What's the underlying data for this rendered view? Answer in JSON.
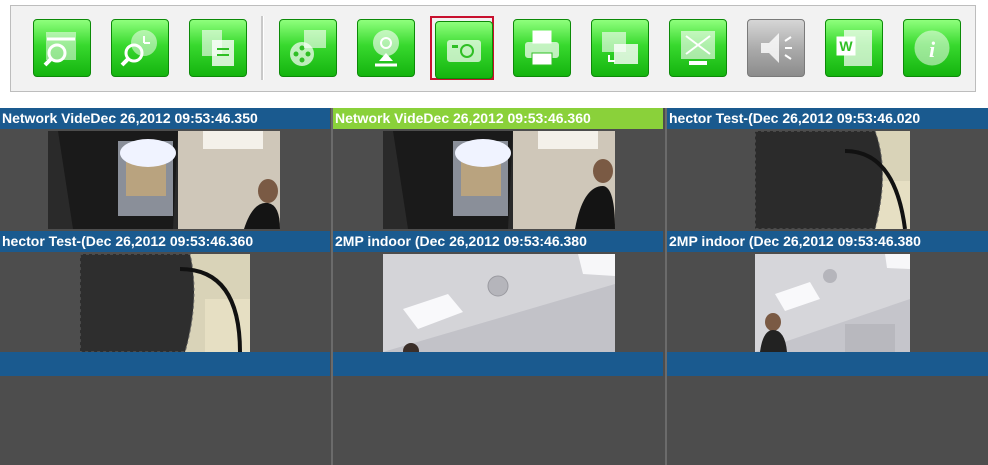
{
  "toolbar": {
    "buttons": [
      {
        "icon": "calendar-search-icon",
        "state": "normal"
      },
      {
        "icon": "clock-search-icon",
        "state": "normal"
      },
      {
        "icon": "documents-icon",
        "state": "normal"
      },
      {
        "icon": "film-reel-icon",
        "state": "normal"
      },
      {
        "icon": "record-upload-icon",
        "state": "normal"
      },
      {
        "icon": "camera-snapshot-icon",
        "state": "selected"
      },
      {
        "icon": "printer-icon",
        "state": "normal"
      },
      {
        "icon": "window-switch-icon",
        "state": "normal"
      },
      {
        "icon": "fullscreen-icon",
        "state": "normal"
      },
      {
        "icon": "speaker-icon",
        "state": "disabled"
      },
      {
        "icon": "word-document-icon",
        "state": "normal"
      },
      {
        "icon": "info-icon",
        "state": "normal"
      }
    ]
  },
  "cameras": [
    {
      "title": "Network VideDec 26,2012 09:53:46.350",
      "scene": "tv-office-person",
      "active": false
    },
    {
      "title": "Network VideDec 26,2012 09:53:46.360",
      "scene": "tv-office-person",
      "active": true
    },
    {
      "title": "hector Test-(Dec 26,2012 09:53:46.020",
      "scene": "mesh-lamp",
      "active": false
    },
    {
      "title": "hector Test-(Dec 26,2012 09:53:46.360",
      "scene": "mesh-lamp",
      "active": false
    },
    {
      "title": "2MP indoor (Dec 26,2012 09:53:46.380",
      "scene": "ceiling",
      "active": false
    },
    {
      "title": "2MP indoor (Dec 26,2012 09:53:46.380",
      "scene": "ceiling-person",
      "active": false
    },
    {
      "title": "",
      "scene": "empty",
      "active": false
    },
    {
      "title": "",
      "scene": "empty",
      "active": false
    },
    {
      "title": "",
      "scene": "empty",
      "active": false
    }
  ],
  "colors": {
    "accent_green": "#8ad13a",
    "title_blue": "#1a5a8f",
    "selected_red": "#c8102e"
  }
}
